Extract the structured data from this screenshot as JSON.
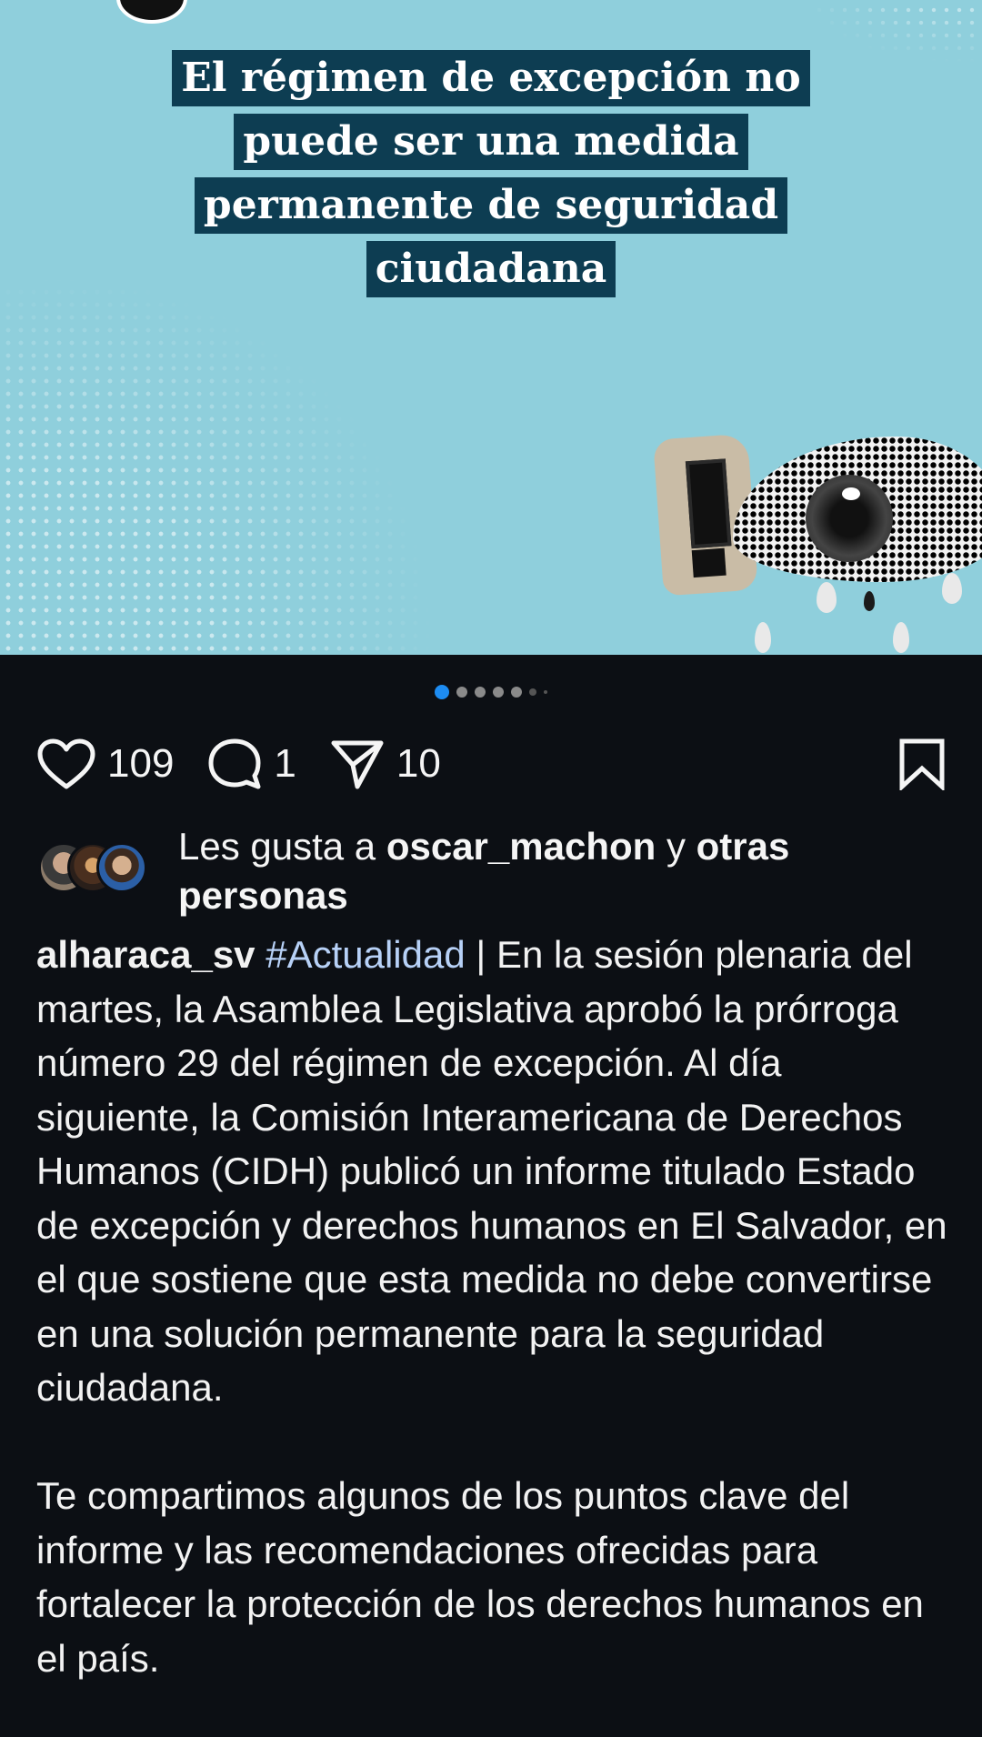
{
  "post_image": {
    "headline_lines": [
      "El régimen de excepción no",
      "puede ser una medida",
      "permanente de seguridad",
      "ciudadana"
    ]
  },
  "carousel": {
    "total_dots": 7,
    "active_index": 0
  },
  "actions": {
    "like_icon": "heart-icon",
    "like_count": "109",
    "comment_icon": "comment-icon",
    "comment_count": "1",
    "share_icon": "send-icon",
    "share_count": "10",
    "save_icon": "bookmark-icon"
  },
  "likes": {
    "prefix": "Les gusta a ",
    "user": "oscar_machon",
    "connector": " y ",
    "others": "otras personas"
  },
  "caption": {
    "username": "alharaca_sv",
    "hashtag": "#Actualidad",
    "paragraph1": " | En la sesión plenaria del martes, la Asamblea Legislativa aprobó la prórroga número 29 del régimen de excepción. Al día siguiente, la Comisión Interamericana de Derechos Humanos (CIDH) publicó un informe titulado Estado de excepción y derechos humanos en El Salvador, en el que sostiene que esta medida no debe convertirse en una solución permanente para la seguridad ciudadana.",
    "paragraph2": "Te compartimos algunos de los puntos clave del informe y las recomendaciones ofrecidas para fortalecer la protección de los derechos humanos en el país."
  },
  "colors": {
    "background": "#0c0f14",
    "image_bg": "#8fcfdc",
    "headline_bg": "#0d3d52",
    "active_dot": "#1d8cf2",
    "hashtag": "#b7d1f7"
  }
}
